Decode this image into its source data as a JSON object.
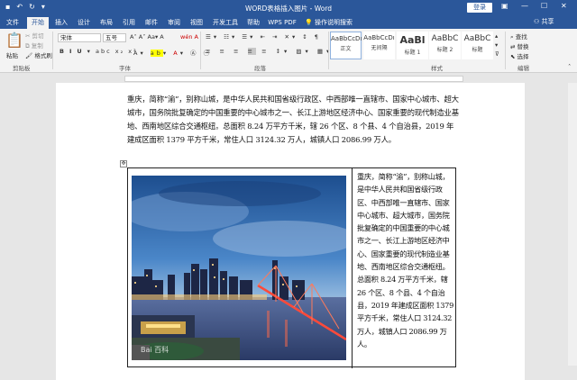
{
  "titlebar": {
    "title": "WORD表格插入图片 - Word",
    "login": "登录"
  },
  "tabs": [
    "文件",
    "开始",
    "插入",
    "设计",
    "布局",
    "引用",
    "邮件",
    "审阅",
    "视图",
    "开发工具",
    "帮助",
    "WPS PDF",
    "操作说明搜索"
  ],
  "share": "共享",
  "clipboard": {
    "paste": "粘贴",
    "cut": "剪切",
    "copy": "复制",
    "format_painter": "格式刷",
    "label": "剪贴板"
  },
  "font": {
    "name": "宋体",
    "size": "五号",
    "label": "字体"
  },
  "paragraph": {
    "label": "段落"
  },
  "styles": {
    "items": [
      {
        "sample": "AaBbCcDı",
        "label": "正文"
      },
      {
        "sample": "AaBbCcDı",
        "label": "无间隔"
      },
      {
        "sample": "AaBl",
        "label": "标题 1"
      },
      {
        "sample": "AaBbC",
        "label": "标题 2"
      },
      {
        "sample": "AaBbC",
        "label": "标题"
      }
    ],
    "label": "样式"
  },
  "editing": {
    "find": "查找",
    "replace": "替换",
    "select": "选择",
    "label": "编辑"
  },
  "body_paragraph": "重庆，简称“渝”，别称山城，是中华人民共和国省级行政区、中西部唯一直辖市、国家中心城市、超大城市，国务院批复确定的中国重要的中心城市之一、长江上游地区经济中心、国家重要的现代制造业基地、西南地区综合交通枢纽。总面积 8.24 万平方千米，辖 26 个区、8 个县、4 个自治县，2019 年建成区面积 1379 平方千米，常住人口 3124.32 万人，城镇人口 2086.99 万人。",
  "cell_text": "重庆，简称“渝”，别称山城，是中华人民共和国省级行政区、中西部唯一直辖市、国家中心城市、超大城市，国务院批复确定的中国重要的中心城市之一、长江上游地区经济中心、国家重要的现代制造业基地、西南地区综合交通枢纽。总面积 8.24 万平方千米，辖 26 个区、8 个县、4 个自治县，2019 年建成区面积 1379 平方千米，常住人口 3124.32 万人，城镇人口 2086.99 万人。",
  "watermark": "Bai 百科"
}
